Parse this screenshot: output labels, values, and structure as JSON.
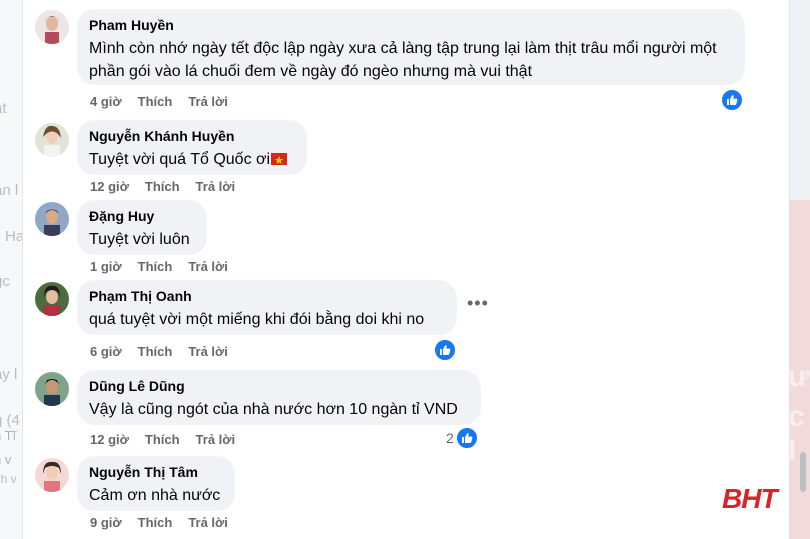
{
  "actions": {
    "like": "Thích",
    "reply": "Trả lời"
  },
  "background": {
    "left_fragments": [
      "ật",
      "an l",
      "Ha",
      "gc",
      "ay l",
      "g (4",
      "h v",
      "h Tĩ",
      "nh v"
    ],
    "right_fragments": [
      "ườ",
      "c I"
    ]
  },
  "comments": [
    {
      "author": "Pham Huyền",
      "text": "Mình còn nhớ ngày tết độc lập ngày xưa cả làng tập trung lại làm thịt trâu mổi người một phần gói vào lá chuối đem về ngày đó ngèo nhưng mà vui thật",
      "time": "4 giờ",
      "reaction_icon": "like-icon"
    },
    {
      "author": "Nguyễn Khánh Huyền",
      "text": "Tuyệt vời quá Tổ Quốc ơi",
      "time": "12 giờ",
      "emoji": "vietnam-flag-icon"
    },
    {
      "author": "Đặng Huy",
      "text": "Tuyệt vời luôn",
      "time": "1 giờ"
    },
    {
      "author": "Phạm Thị Oanh",
      "text": "quá tuyệt vời một miếng khi đói bằng doi khi no",
      "time": "6 giờ",
      "reaction_icon": "like-icon",
      "more_icon": "more-options-icon"
    },
    {
      "author": "Dũng Lê Dũng",
      "text": "Vậy là cũng ngót của nhà nước hơn 10 ngàn tỉ VND",
      "time": "12 giờ",
      "reaction_icon": "like-icon",
      "reaction_count": "2"
    },
    {
      "author": "Nguyễn Thị Tâm",
      "text": "Cảm ơn nhà nước",
      "time": "9 giờ"
    }
  ],
  "watermark": "BHT",
  "colors": {
    "accent": "#1877f2",
    "bubble": "#f0f2f5",
    "watermark": "#d9222a"
  }
}
